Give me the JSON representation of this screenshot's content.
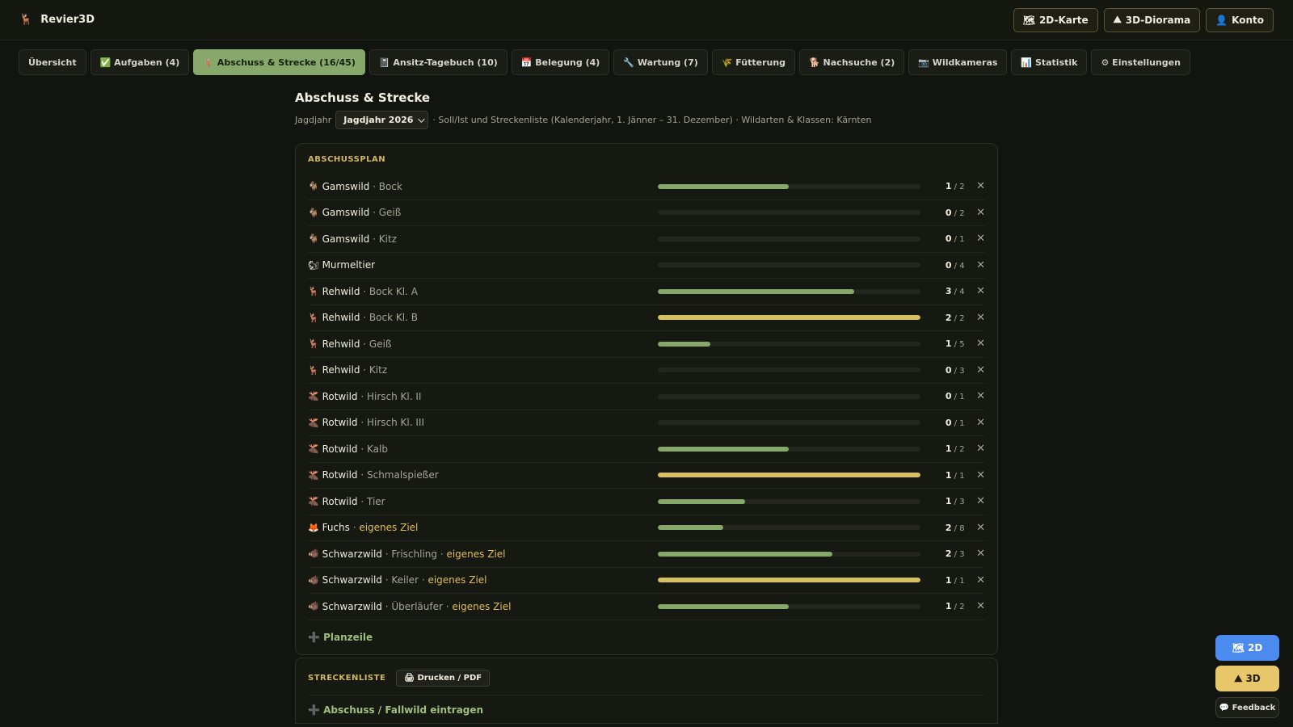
{
  "app": {
    "title": "Revier3D",
    "logo_icon": "🦌"
  },
  "header": {
    "actions": [
      {
        "icon": "🗺",
        "label": "2D-Karte"
      },
      {
        "icon": "⛰",
        "label": "3D-Diorama"
      },
      {
        "icon": "👤",
        "label": "Konto"
      }
    ]
  },
  "tabs": [
    {
      "label": "Übersicht",
      "active": false
    },
    {
      "label": "✅ Aufgaben (4)",
      "active": false
    },
    {
      "label": "🦌 Abschuss & Strecke (16/45)",
      "active": true
    },
    {
      "label": "📓 Ansitz-Tagebuch (10)",
      "active": false
    },
    {
      "label": "📅 Belegung (4)",
      "active": false
    },
    {
      "label": "🔧 Wartung (7)",
      "active": false
    },
    {
      "label": "🌾 Fütterung",
      "active": false
    },
    {
      "label": "🐕 Nachsuche (2)",
      "active": false
    },
    {
      "label": "📷 Wildkameras",
      "active": false
    },
    {
      "label": "📊 Statistik",
      "active": false
    },
    {
      "label": "⚙ Einstellungen",
      "active": false
    }
  ],
  "page": {
    "title": "Abschuss & Strecke",
    "year_label": "Jagdjahr",
    "year_value": "Jagdjahr 2026",
    "subtitle": "· Soll/Ist und Streckenliste (Kalenderjahr, 1. Jänner – 31. Dezember) · Wildarten & Klassen: Kärnten"
  },
  "plan": {
    "heading": "ABSCHUSSPLAN",
    "rows": [
      {
        "emoji": "🐐",
        "species": "Gamswild",
        "klass": "Bock",
        "goal": "",
        "ist": "1",
        "soll": "2",
        "ratio": 0.5
      },
      {
        "emoji": "🐐",
        "species": "Gamswild",
        "klass": "Geiß",
        "goal": "",
        "ist": "0",
        "soll": "2",
        "ratio": 0
      },
      {
        "emoji": "🐐",
        "species": "Gamswild",
        "klass": "Kitz",
        "goal": "",
        "ist": "0",
        "soll": "1",
        "ratio": 0
      },
      {
        "emoji": "🐿",
        "species": "Murmeltier",
        "klass": "",
        "goal": "",
        "ist": "0",
        "soll": "4",
        "ratio": 0
      },
      {
        "emoji": "🦌",
        "species": "Rehwild",
        "klass": "Bock Kl. A",
        "goal": "",
        "ist": "3",
        "soll": "4",
        "ratio": 0.75
      },
      {
        "emoji": "🦌",
        "species": "Rehwild",
        "klass": "Bock Kl. B",
        "goal": "",
        "ist": "2",
        "soll": "2",
        "ratio": 1
      },
      {
        "emoji": "🦌",
        "species": "Rehwild",
        "klass": "Geiß",
        "goal": "",
        "ist": "1",
        "soll": "5",
        "ratio": 0.2
      },
      {
        "emoji": "🦌",
        "species": "Rehwild",
        "klass": "Kitz",
        "goal": "",
        "ist": "0",
        "soll": "3",
        "ratio": 0
      },
      {
        "emoji": "🫎",
        "species": "Rotwild",
        "klass": "Hirsch Kl. II",
        "goal": "",
        "ist": "0",
        "soll": "1",
        "ratio": 0
      },
      {
        "emoji": "🫎",
        "species": "Rotwild",
        "klass": "Hirsch Kl. III",
        "goal": "",
        "ist": "0",
        "soll": "1",
        "ratio": 0
      },
      {
        "emoji": "🫎",
        "species": "Rotwild",
        "klass": "Kalb",
        "goal": "",
        "ist": "1",
        "soll": "2",
        "ratio": 0.5
      },
      {
        "emoji": "🫎",
        "species": "Rotwild",
        "klass": "Schmalspießer",
        "goal": "",
        "ist": "1",
        "soll": "1",
        "ratio": 1
      },
      {
        "emoji": "🫎",
        "species": "Rotwild",
        "klass": "Tier",
        "goal": "",
        "ist": "1",
        "soll": "3",
        "ratio": 0.3333
      },
      {
        "emoji": "🦊",
        "species": "Fuchs",
        "klass": "",
        "goal": "eigenes Ziel",
        "ist": "2",
        "soll": "8",
        "ratio": 0.25
      },
      {
        "emoji": "🐗",
        "species": "Schwarzwild",
        "klass": "Frischling",
        "goal": "eigenes Ziel",
        "ist": "2",
        "soll": "3",
        "ratio": 0.6667
      },
      {
        "emoji": "🐗",
        "species": "Schwarzwild",
        "klass": "Keiler",
        "goal": "eigenes Ziel",
        "ist": "1",
        "soll": "1",
        "ratio": 1
      },
      {
        "emoji": "🐗",
        "species": "Schwarzwild",
        "klass": "Überläufer",
        "goal": "eigenes Ziel",
        "ist": "1",
        "soll": "2",
        "ratio": 0.5
      }
    ],
    "add_label": "➕ Planzeile"
  },
  "strecke": {
    "heading": "STRECKENLISTE",
    "print_label": "🖨 Drucken / PDF",
    "add_label": "➕ Abschuss / Fallwild eintragen"
  },
  "floating": {
    "btn_2d": "🗺 2D",
    "btn_3d": "⛰ 3D",
    "feedback": "💬 Feedback"
  },
  "colors": {
    "progress": "#86a86a",
    "progress_full": "#d8c062",
    "accent_gold": "#e0bd5a",
    "btn_2d": "#4b8bf0",
    "btn_3d": "#e8c76a"
  }
}
